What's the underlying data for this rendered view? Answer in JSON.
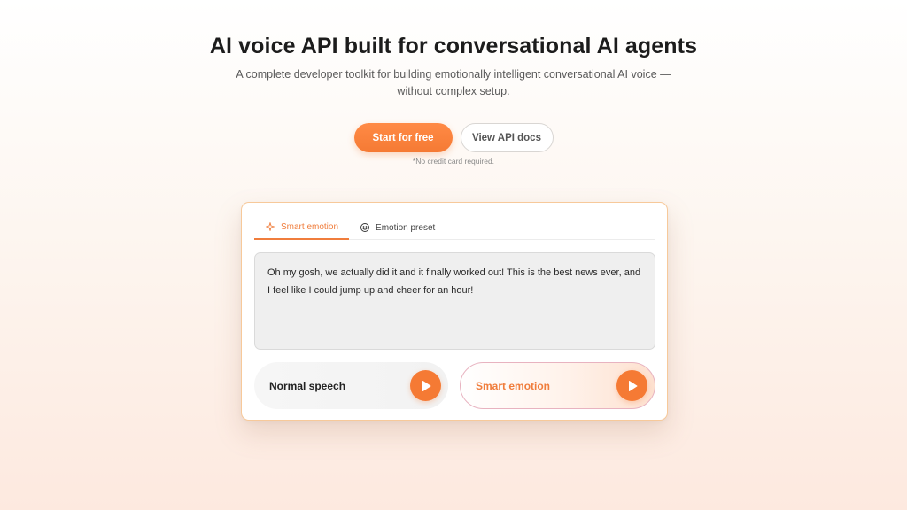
{
  "hero": {
    "title": "AI voice API built for conversational AI agents",
    "subtitle": "A complete developer toolkit for building emotionally intelligent conversational AI voice —without complex setup."
  },
  "cta": {
    "primary_label": "Start for free",
    "secondary_label": "View API docs",
    "note": "*No credit card required."
  },
  "demo": {
    "tabs": [
      {
        "label": "Smart emotion",
        "icon": "sparkle-icon",
        "active": true
      },
      {
        "label": "Emotion preset",
        "icon": "smiley-icon",
        "active": false
      }
    ],
    "text": "Oh my gosh, we actually did it and it finally worked out! This is the best news ever, and I feel like I could jump up and cheer for an hour!",
    "options": [
      {
        "label": "Normal speech",
        "icon": "play-icon"
      },
      {
        "label": "Smart emotion",
        "icon": "play-icon"
      }
    ]
  },
  "colors": {
    "accent": "#f57a34",
    "card_border": "#f7c99a",
    "smart_border": "#e8b3c0"
  }
}
